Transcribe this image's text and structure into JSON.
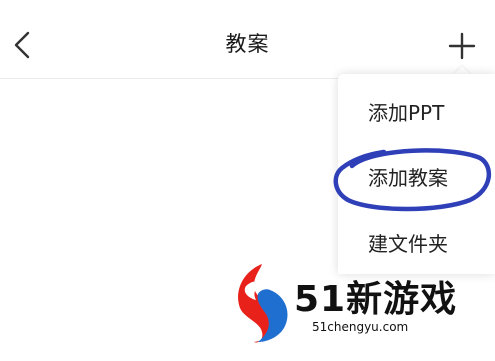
{
  "header": {
    "title": "教案",
    "back_icon": "chevron-left-icon",
    "add_icon": "plus-icon"
  },
  "menu": {
    "items": [
      {
        "label": "添加PPT"
      },
      {
        "label": "添加教案",
        "highlighted": true
      },
      {
        "label": "建文件夹"
      }
    ]
  },
  "watermark": {
    "brand": "51新游戏",
    "url": "51chengyu.com"
  },
  "colors": {
    "highlight_circle": "#2e3fb8",
    "logo_red": "#e8221b",
    "logo_blue": "#1f6fd1"
  }
}
